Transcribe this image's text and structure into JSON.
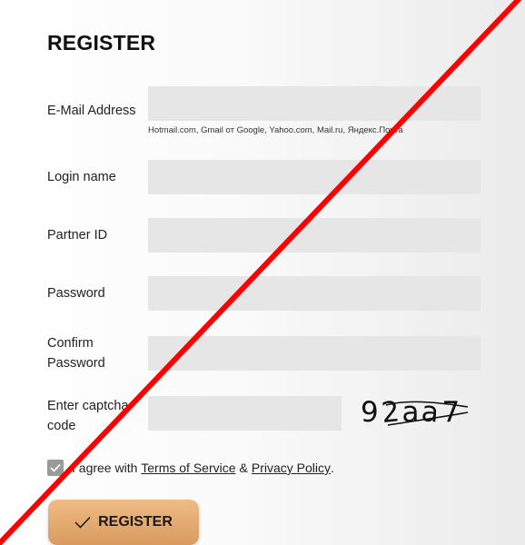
{
  "form": {
    "title": "REGISTER",
    "email": {
      "label": "E-Mail Address",
      "value": "",
      "hint": "Hotmail.com, Gmail от Google, Yahoo.com, Mail.ru, Яндекс.Почта"
    },
    "login": {
      "label": "Login name",
      "value": ""
    },
    "partner": {
      "label": "Partner ID",
      "value": ""
    },
    "password": {
      "label": "Password",
      "value": ""
    },
    "confirm": {
      "label_line1": "Confirm",
      "label_line2": "Password",
      "value": ""
    },
    "captcha": {
      "label_line1": "Enter captcha",
      "label_line2": "code",
      "value": "",
      "code": [
        "9",
        "2",
        "a",
        "a",
        "7"
      ]
    },
    "agree": {
      "checked": true,
      "prefix": "I agree with",
      "terms_link": "Terms of Service",
      "separator": "&",
      "privacy_link": "Privacy Policy",
      "suffix": "."
    },
    "submit_label": "REGISTER"
  },
  "icons": {
    "checkbox_check": "check-icon",
    "button_check": "check-icon"
  },
  "colors": {
    "field_bg": "#e6e6e6",
    "button_gradient_top": "#efbc86",
    "button_gradient_bottom": "#d99a5e",
    "checkbox_bg": "#9a9a9a",
    "strike_line": "#ff0000"
  }
}
